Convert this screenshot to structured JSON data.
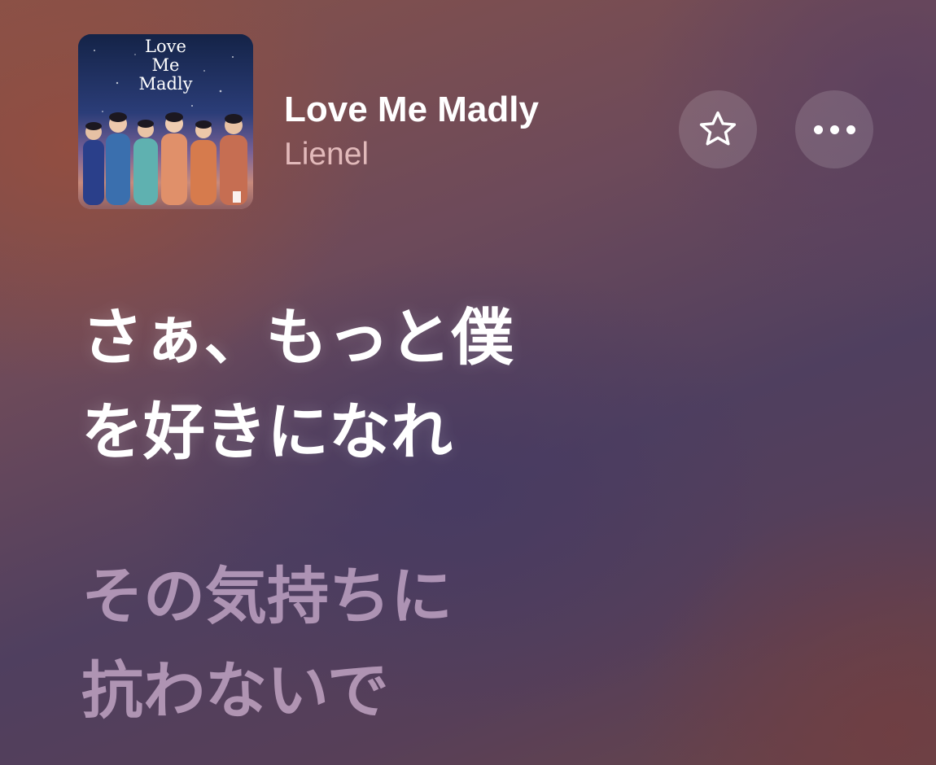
{
  "now_playing": {
    "album_art_title": "Love\nMe\nMadly",
    "title": "Love Me Madly",
    "artist": "Lienel"
  },
  "actions": {
    "favorite_icon": "star-outline-icon",
    "more_icon": "ellipsis-icon"
  },
  "lyrics": [
    {
      "lines": [
        "さぁ、もっと僕",
        "を好きになれ"
      ],
      "state": "active"
    },
    {
      "lines": [
        "その気持ちに",
        "抗わないで"
      ],
      "state": "upcoming"
    }
  ],
  "colors": {
    "active_lyric": "#ffffff",
    "upcoming_lyric": "#e8c8e8",
    "artist_text": "#f5cdcd"
  }
}
